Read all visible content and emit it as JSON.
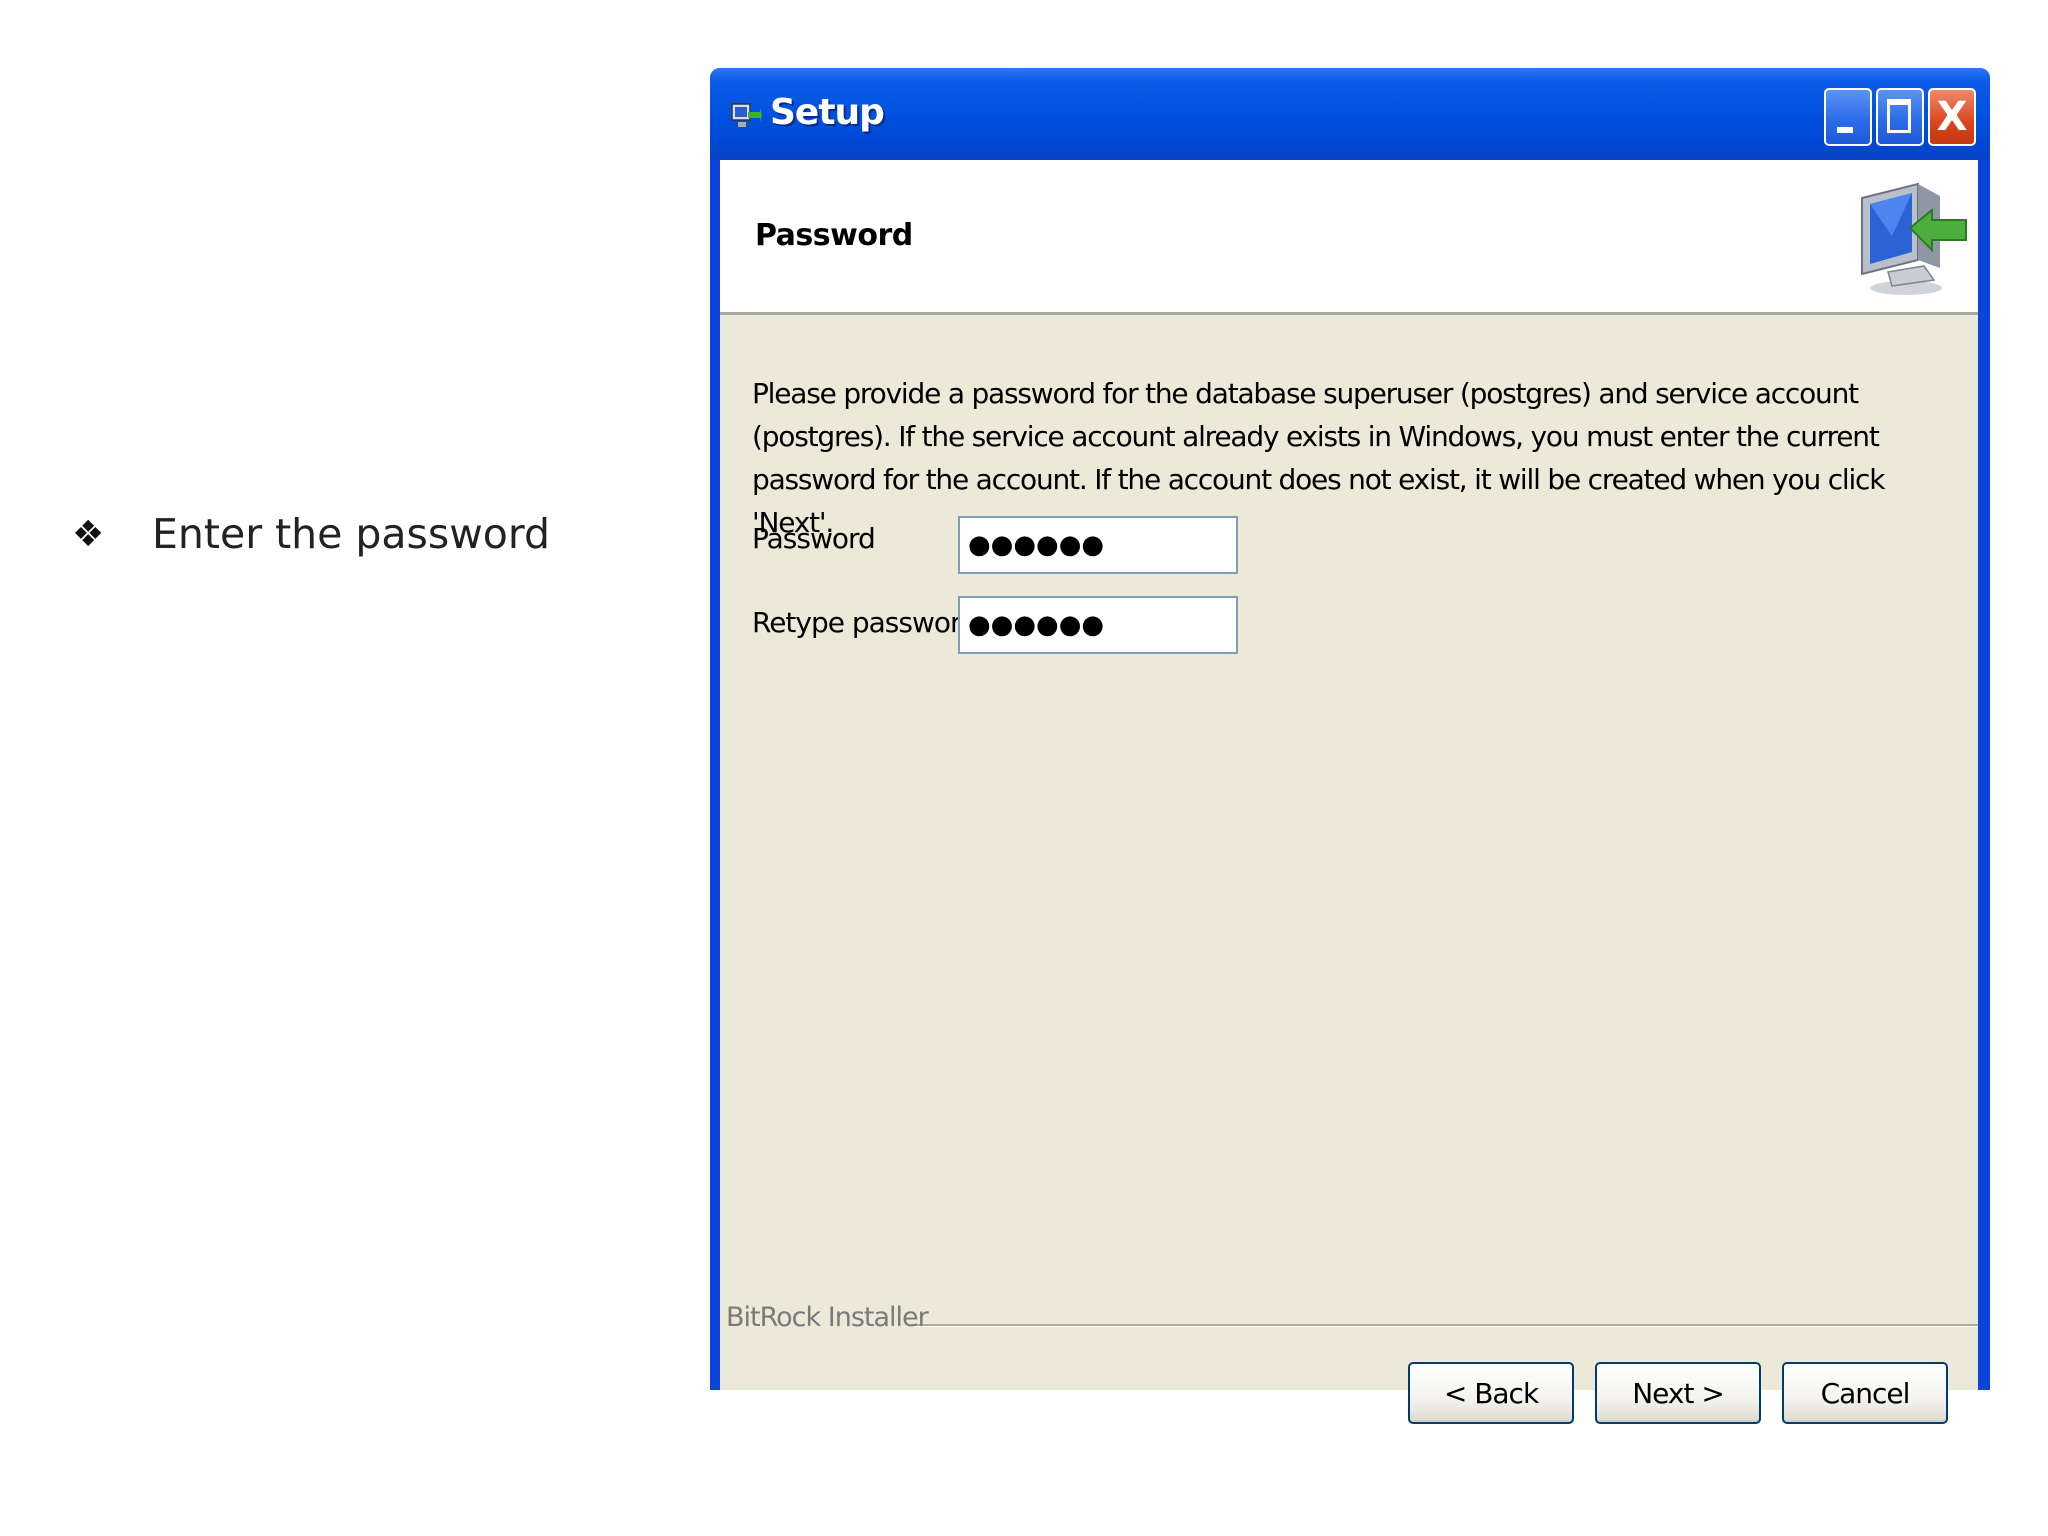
{
  "slide": {
    "bullet_glyph": "❖",
    "bullet_text": "Enter the password"
  },
  "window": {
    "title": "Setup",
    "app_icon": "setup-installer-icon",
    "controls": {
      "minimize_icon": "minimize-icon",
      "maximize_icon": "maximize-icon",
      "close_icon": "close-icon",
      "close_glyph": "X"
    }
  },
  "page": {
    "header_title": "Password",
    "header_icon": "computer-install-icon",
    "description": "Please provide a password for the database superuser (postgres) and service account (postgres). If the service account already exists in Windows, you must enter the current password for the account. If the account does not exist, it will be created when you click 'Next'.",
    "fields": {
      "password_label": "Password",
      "password_value": "●●●●●●",
      "retype_label": "Retype password",
      "retype_value": "●●●●●●"
    }
  },
  "footer": {
    "installer_label": "BitRock Installer",
    "back_label": "< Back",
    "next_label": "Next >",
    "cancel_label": "Cancel"
  },
  "colors": {
    "titlebar": "#0052e0",
    "client_bg": "#ece9d8",
    "header_bg": "#ffffff",
    "close_button": "#d9451e",
    "button_border": "#003c74"
  }
}
